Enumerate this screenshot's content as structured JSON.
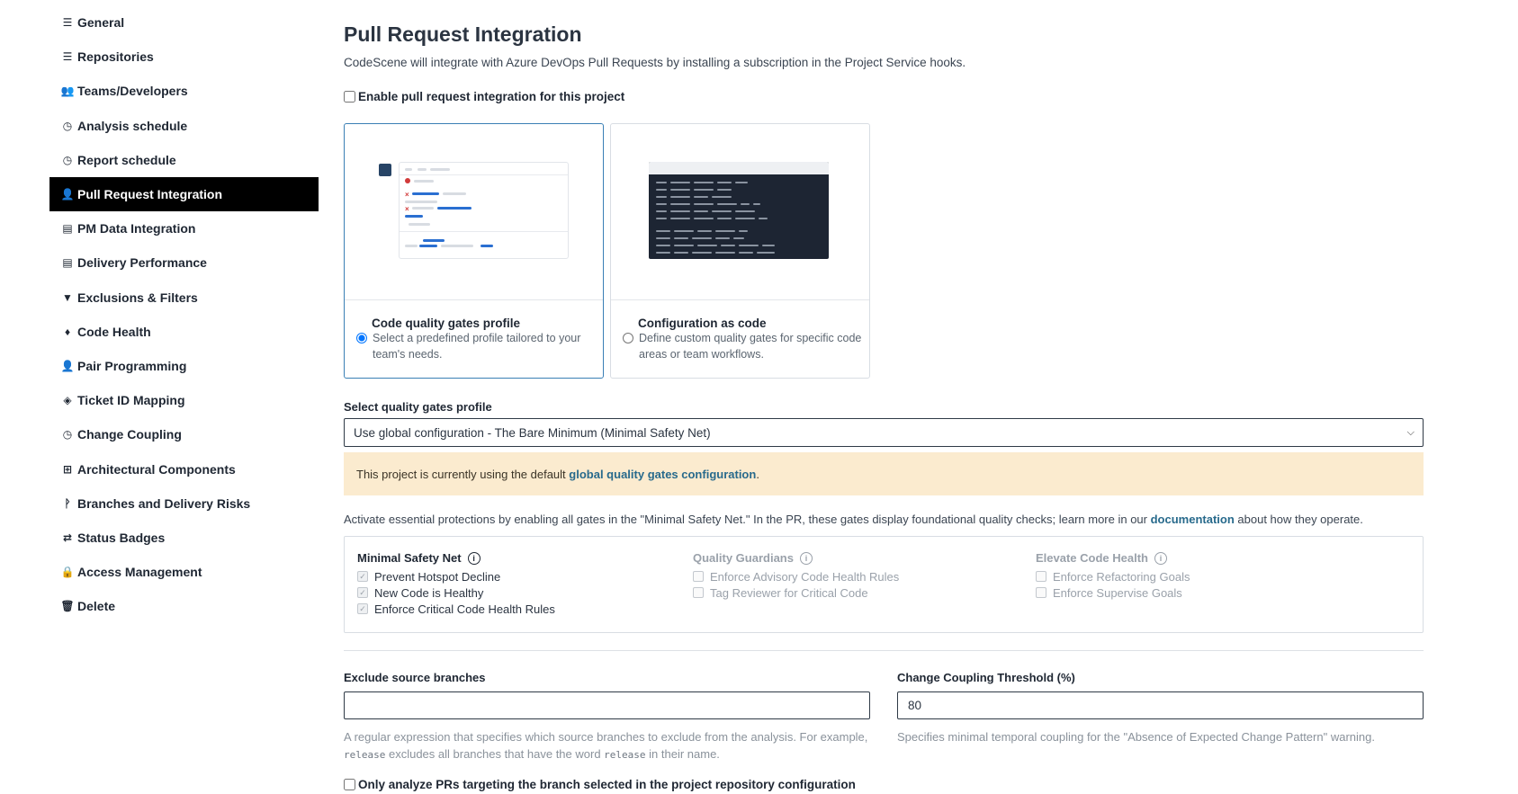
{
  "sidebar": {
    "items": [
      {
        "label": "General",
        "icon": "sliders-icon",
        "glyph": "☰"
      },
      {
        "label": "Repositories",
        "icon": "sliders-icon",
        "glyph": "☰"
      },
      {
        "label": "Teams/Developers",
        "icon": "users-icon",
        "glyph": "👥"
      },
      {
        "label": "Analysis schedule",
        "icon": "clock-icon",
        "glyph": "◷"
      },
      {
        "label": "Report schedule",
        "icon": "clock-icon",
        "glyph": "◷"
      },
      {
        "label": "Pull Request Integration",
        "icon": "user-icon",
        "glyph": "👤",
        "active": true
      },
      {
        "label": "PM Data Integration",
        "icon": "list-icon",
        "glyph": "▤"
      },
      {
        "label": "Delivery Performance",
        "icon": "list-icon",
        "glyph": "▤"
      },
      {
        "label": "Exclusions & Filters",
        "icon": "filter-icon",
        "glyph": "▼"
      },
      {
        "label": "Code Health",
        "icon": "flame-icon",
        "glyph": "♦"
      },
      {
        "label": "Pair Programming",
        "icon": "user-plus-icon",
        "glyph": "👤"
      },
      {
        "label": "Ticket ID Mapping",
        "icon": "tag-icon",
        "glyph": "◈"
      },
      {
        "label": "Change Coupling",
        "icon": "clock-icon",
        "glyph": "◷"
      },
      {
        "label": "Architectural Components",
        "icon": "sitemap-icon",
        "glyph": "⊞"
      },
      {
        "label": "Branches and Delivery Risks",
        "icon": "branch-icon",
        "glyph": "ᚹ"
      },
      {
        "label": "Status Badges",
        "icon": "exchange-icon",
        "glyph": "⇄"
      },
      {
        "label": "Access Management",
        "icon": "lock-icon",
        "glyph": "🔒"
      },
      {
        "label": "Delete",
        "icon": "trash-icon",
        "glyph": "🗑"
      }
    ]
  },
  "main": {
    "title": "Pull Request Integration",
    "subtitle": "CodeScene will integrate with Azure DevOps Pull Requests by installing a subscription in the Project Service hooks.",
    "enable_label": "Enable pull request integration for this project",
    "cards": [
      {
        "title": "Code quality gates profile",
        "desc": "Select a predefined profile tailored to your team's needs.",
        "selected": true
      },
      {
        "title": "Configuration as code",
        "desc": "Define custom quality gates for specific code areas or team workflows.",
        "selected": false
      }
    ],
    "select_label": "Select quality gates profile",
    "select_value": "Use global configuration - The Bare Minimum (Minimal Safety Net)",
    "notice_text": "This project is currently using the default ",
    "notice_link": "global quality gates configuration",
    "notice_end": ".",
    "activate_text": "Activate essential protections by enabling all gates in the \"Minimal Safety Net.\" In the PR, these gates display foundational quality checks; learn more in our ",
    "activate_link": "documentation",
    "activate_end": " about how they operate.",
    "gate_groups": [
      {
        "title": "Minimal Safety Net",
        "active": true,
        "items": [
          "Prevent Hotspot Decline",
          "New Code is Healthy",
          "Enforce Critical Code Health Rules"
        ]
      },
      {
        "title": "Quality Guardians",
        "active": false,
        "items": [
          "Enforce Advisory Code Health Rules",
          "Tag Reviewer for Critical Code"
        ]
      },
      {
        "title": "Elevate Code Health",
        "active": false,
        "items": [
          "Enforce Refactoring Goals",
          "Enforce Supervise Goals"
        ]
      }
    ],
    "exclude_label": "Exclude source branches",
    "exclude_value": "",
    "exclude_help_1": "A regular expression that specifies which source branches to exclude from the analysis. For example, ",
    "exclude_help_code": "release",
    "exclude_help_2": " excludes all branches that have the word ",
    "exclude_help_code2": "release",
    "exclude_help_3": " in their name.",
    "coupling_label": "Change Coupling Threshold (%)",
    "coupling_value": "80",
    "coupling_help": "Specifies minimal temporal coupling for the \"Absence of Expected Change Pattern\" warning.",
    "only_label": "Only analyze PRs targeting the branch selected in the project repository configuration"
  },
  "colors": {
    "active_bg": "#000000",
    "notice_bg": "#fbebcf",
    "link": "#286a8c",
    "selected_border": "#3a7fb5"
  }
}
